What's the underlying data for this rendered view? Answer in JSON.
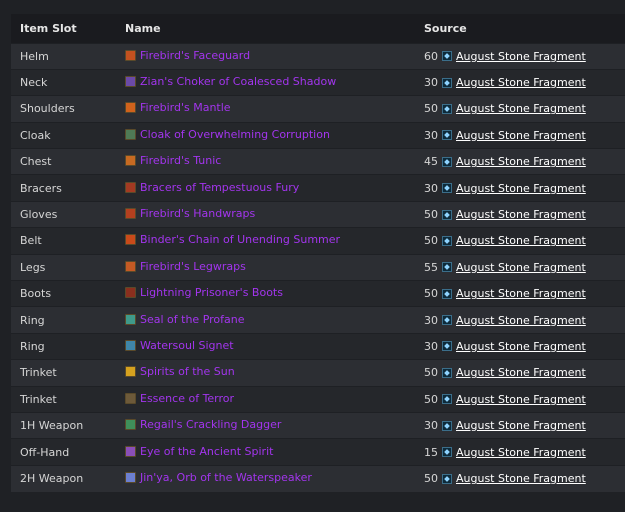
{
  "table": {
    "headers": {
      "slot": "Item Slot",
      "name": "Name",
      "source": "Source"
    },
    "currency": {
      "name": "August Stone Fragment",
      "icon": "stone-fragment-icon"
    },
    "rows": [
      {
        "slot": "Helm",
        "name": "Firebird's Faceguard",
        "cost": "60",
        "icon_color": "#c2511f"
      },
      {
        "slot": "Neck",
        "name": "Zian's Choker of Coalesced Shadow",
        "cost": "30",
        "icon_color": "#6b4aa8"
      },
      {
        "slot": "Shoulders",
        "name": "Firebird's Mantle",
        "cost": "50",
        "icon_color": "#d0621c"
      },
      {
        "slot": "Cloak",
        "name": "Cloak of Overwhelming Corruption",
        "cost": "30",
        "icon_color": "#4f7a55"
      },
      {
        "slot": "Chest",
        "name": "Firebird's Tunic",
        "cost": "45",
        "icon_color": "#c76a22"
      },
      {
        "slot": "Bracers",
        "name": "Bracers of Tempestuous Fury",
        "cost": "30",
        "icon_color": "#a33a22"
      },
      {
        "slot": "Gloves",
        "name": "Firebird's Handwraps",
        "cost": "50",
        "icon_color": "#b3401f"
      },
      {
        "slot": "Belt",
        "name": "Binder's Chain of Unending Summer",
        "cost": "50",
        "icon_color": "#c94a1a"
      },
      {
        "slot": "Legs",
        "name": "Firebird's Legwraps",
        "cost": "55",
        "icon_color": "#c45a24"
      },
      {
        "slot": "Boots",
        "name": "Lightning Prisoner's Boots",
        "cost": "50",
        "icon_color": "#8a2f1e"
      },
      {
        "slot": "Ring",
        "name": "Seal of the Profane",
        "cost": "30",
        "icon_color": "#3f9a8a"
      },
      {
        "slot": "Ring",
        "name": "Watersoul Signet",
        "cost": "30",
        "icon_color": "#3f86a8"
      },
      {
        "slot": "Trinket",
        "name": "Spirits of the Sun",
        "cost": "50",
        "icon_color": "#d6a21f"
      },
      {
        "slot": "Trinket",
        "name": "Essence of Terror",
        "cost": "50",
        "icon_color": "#6d5a3a"
      },
      {
        "slot": "1H Weapon",
        "name": "Regail's Crackling Dagger",
        "cost": "30",
        "icon_color": "#3f8f5a"
      },
      {
        "slot": "Off-Hand",
        "name": "Eye of the Ancient Spirit",
        "cost": "15",
        "icon_color": "#8a4fb8"
      },
      {
        "slot": "2H Weapon",
        "name": "Jin'ya, Orb of the Waterspeaker",
        "cost": "50",
        "icon_color": "#6c7fd0"
      }
    ]
  }
}
